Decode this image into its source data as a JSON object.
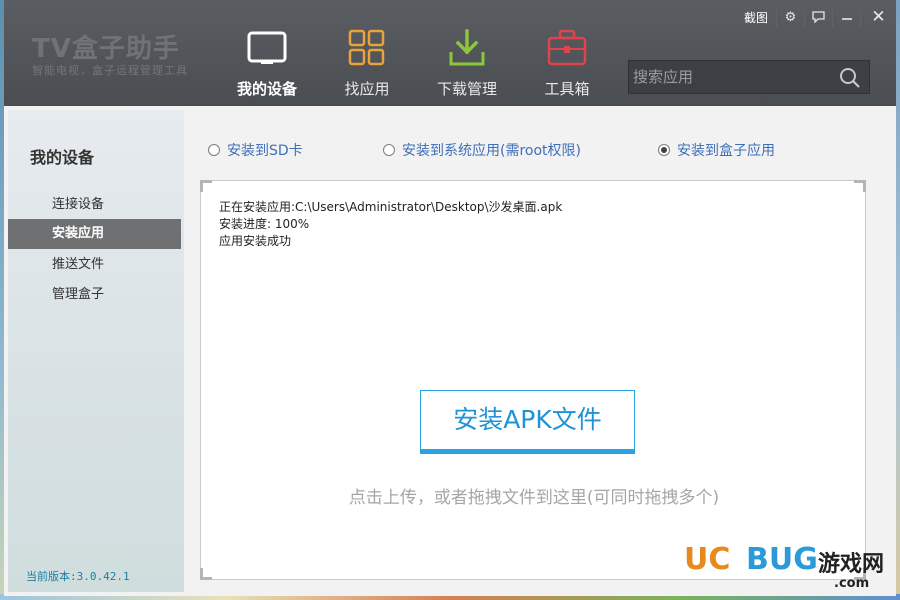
{
  "header": {
    "logo_title": "TV盒子助手",
    "logo_subtitle": "智能电视，盒子远程管理工具",
    "nav": [
      {
        "label": "我的设备",
        "icon": "tablet-icon",
        "active": true
      },
      {
        "label": "找应用",
        "icon": "app-grid-icon",
        "active": false
      },
      {
        "label": "下载管理",
        "icon": "download-icon",
        "active": false
      },
      {
        "label": "工具箱",
        "icon": "toolbox-icon",
        "active": false
      }
    ],
    "screenshot_label": "截图",
    "search_placeholder": "搜索应用"
  },
  "sidebar": {
    "title": "我的设备",
    "items": [
      {
        "label": "连接设备",
        "active": false
      },
      {
        "label": "安装应用",
        "active": true
      },
      {
        "label": "推送文件",
        "active": false
      },
      {
        "label": "管理盒子",
        "active": false
      }
    ],
    "version": "当前版本:3.0.42.1"
  },
  "main": {
    "options": [
      {
        "label": "安装到SD卡",
        "checked": false
      },
      {
        "label": "安装到系统应用(需root权限)",
        "checked": false
      },
      {
        "label": "安装到盒子应用",
        "checked": true
      }
    ],
    "log": [
      "正在安装应用:C:\\Users\\Administrator\\Desktop\\沙发桌面.apk",
      "安装进度:  100%",
      "应用安装成功"
    ],
    "install_button": "安装APK文件",
    "drop_hint": "点击上传，或者拖拽文件到这里(可同时拖拽多个)"
  },
  "watermark": {
    "brand_uc": "UC",
    "brand_bug": "BUG",
    "brand_cn": "游戏网",
    "domain": ".com"
  },
  "colors": {
    "header_bg": "#4e5155",
    "accent_blue": "#2aa3e0",
    "sidebar_active": "#6f7072",
    "icon_orange": "#e8a33a",
    "icon_green": "#8cc63f",
    "icon_red": "#e0444b"
  }
}
